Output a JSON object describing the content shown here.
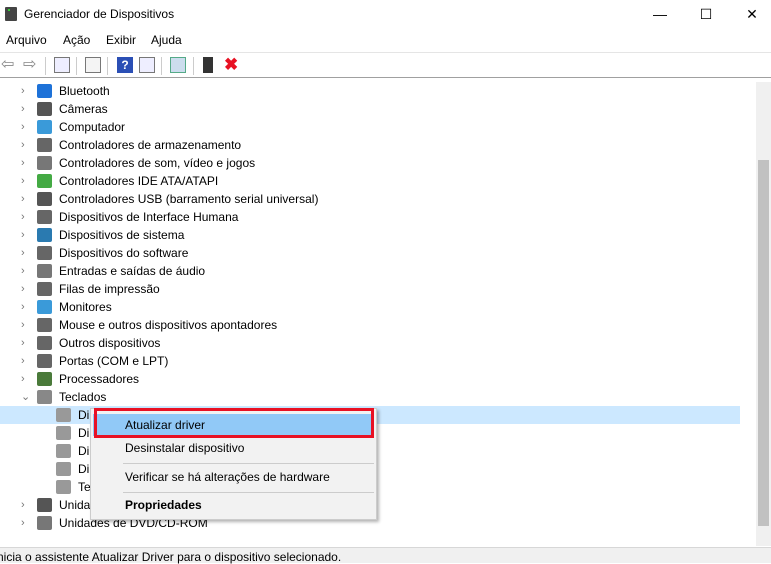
{
  "window": {
    "title": "Gerenciador de Dispositivos",
    "minimize": "—",
    "maximize": "☐",
    "close": "✕"
  },
  "menu": [
    "Arquivo",
    "Ação",
    "Exibir",
    "Ajuda"
  ],
  "toolbar": [
    "back-icon",
    "forward-icon",
    "show-hide-tree-icon",
    "properties-icon",
    "help-icon",
    "action-pane-icon",
    "scan-hardware-icon",
    "update-driver-icon",
    "uninstall-icon"
  ],
  "tree": [
    {
      "label": "Bluetooth",
      "icon": "bluetooth-icon",
      "color": "#1e72d8"
    },
    {
      "label": "Câmeras",
      "icon": "camera-icon",
      "color": "#555"
    },
    {
      "label": "Computador",
      "icon": "computer-icon",
      "color": "#3a9ad9"
    },
    {
      "label": "Controladores de armazenamento",
      "icon": "storage-controller-icon",
      "color": "#666"
    },
    {
      "label": "Controladores de som, vídeo e jogos",
      "icon": "speaker-icon",
      "color": "#777"
    },
    {
      "label": "Controladores IDE ATA/ATAPI",
      "icon": "ide-icon",
      "color": "#4a4"
    },
    {
      "label": "Controladores USB (barramento serial universal)",
      "icon": "usb-icon",
      "color": "#555"
    },
    {
      "label": "Dispositivos de Interface Humana",
      "icon": "hid-icon",
      "color": "#666"
    },
    {
      "label": "Dispositivos de sistema",
      "icon": "system-device-icon",
      "color": "#2a7ab0"
    },
    {
      "label": "Dispositivos do software",
      "icon": "software-device-icon",
      "color": "#666"
    },
    {
      "label": "Entradas e saídas de áudio",
      "icon": "audio-icon",
      "color": "#777"
    },
    {
      "label": "Filas de impressão",
      "icon": "printer-icon",
      "color": "#666"
    },
    {
      "label": "Monitores",
      "icon": "monitor-icon",
      "color": "#3a9ad9"
    },
    {
      "label": "Mouse e outros dispositivos apontadores",
      "icon": "mouse-icon",
      "color": "#666"
    },
    {
      "label": "Outros dispositivos",
      "icon": "unknown-device-icon",
      "color": "#666"
    },
    {
      "label": "Portas (COM e LPT)",
      "icon": "port-icon",
      "color": "#666"
    },
    {
      "label": "Processadores",
      "icon": "processor-icon",
      "color": "#4a7a3a"
    },
    {
      "label": "Teclados",
      "icon": "keyboard-icon",
      "color": "#888",
      "expanded": true
    }
  ],
  "keyboards": [
    "Di",
    "Di",
    "Di",
    "Di",
    "Te"
  ],
  "tree_after": [
    {
      "label": "Unida",
      "icon": "disk-drive-icon",
      "color": "#555"
    },
    {
      "label": "Unidades de DVD/CD-ROM",
      "icon": "dvd-icon",
      "color": "#777"
    }
  ],
  "context_menu": {
    "update": "Atualizar driver",
    "uninstall": "Desinstalar dispositivo",
    "scan": "Verificar se há alterações de hardware",
    "properties": "Propriedades"
  },
  "status": "nicia o assistente Atualizar Driver para o dispositivo selecionado."
}
